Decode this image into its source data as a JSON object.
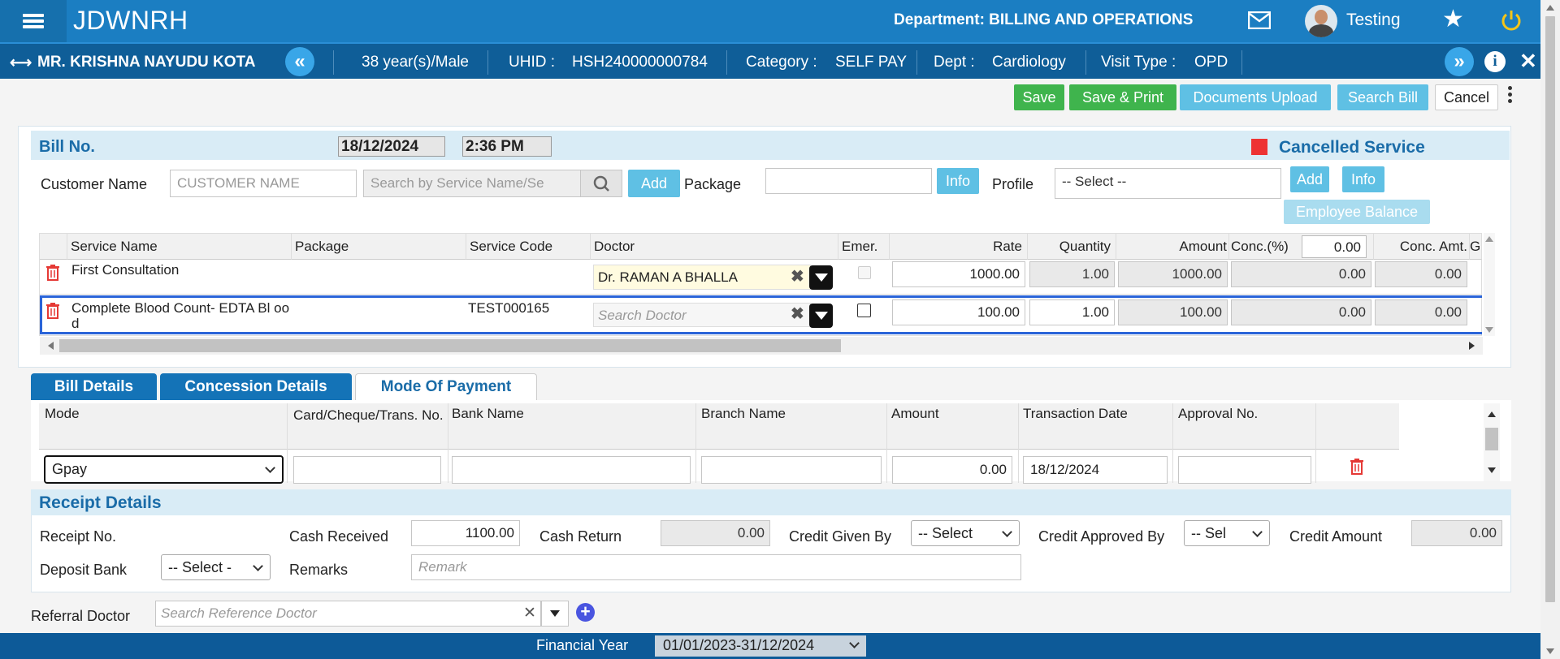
{
  "app": {
    "title": "JDWNRH",
    "department_label": "Department: BILLING AND OPERATIONS",
    "user": "Testing"
  },
  "patient": {
    "name": "MR. KRISHNA NAYUDU KOTA",
    "age_sex": "38 year(s)/Male",
    "uhid_label": "UHID :",
    "uhid": "HSH240000000784",
    "category_label": "Category :",
    "category": "SELF PAY",
    "dept_label": "Dept :",
    "dept": "Cardiology",
    "visit_label": "Visit Type :",
    "visit": "OPD"
  },
  "toolbar": {
    "save": "Save",
    "save_print": "Save & Print",
    "docs": "Documents Upload",
    "search_bill": "Search Bill",
    "cancel": "Cancel"
  },
  "bill": {
    "title": "Bill No.",
    "date": "18/12/2024",
    "time": "2:36 PM",
    "cancelled_label": "Cancelled Service",
    "customer_label": "Customer Name",
    "customer_placeholder": "CUSTOMER NAME",
    "service_placeholder": "Search by Service Name/Se",
    "add": "Add",
    "package_label": "Package",
    "info": "Info",
    "profile_label": "Profile",
    "profile_value": "-- Select --",
    "add2": "Add",
    "info2": "Info",
    "employee_balance": "Employee Balance"
  },
  "grid": {
    "headers": {
      "service": "Service Name",
      "package": "Package",
      "code": "Service Code",
      "doctor": "Doctor",
      "emer": "Emer.",
      "rate": "Rate",
      "qty": "Quantity",
      "amount": "Amount",
      "conc_pct": "Conc.(%)",
      "conc_pct_value": "0.00",
      "conc_amt": "Conc. Amt.",
      "g": "G"
    },
    "rows": [
      {
        "service": "First Consultation",
        "package": "",
        "code": "",
        "doctor": "Dr. RAMAN A BHALLA",
        "rate": "1000.00",
        "qty": "1.00",
        "amount": "1000.00",
        "conc_pct": "0.00",
        "conc_amt": "0.00"
      },
      {
        "service": "Complete Blood Count- EDTA Bl ood",
        "package": "",
        "code": "TEST000165",
        "doctor_placeholder": "Search Doctor",
        "rate": "100.00",
        "qty": "1.00",
        "amount": "100.00",
        "conc_pct": "0.00",
        "conc_amt": "0.00"
      }
    ]
  },
  "tabs": {
    "bill_details": "Bill Details",
    "concession": "Concession Details",
    "payment": "Mode Of Payment"
  },
  "payment": {
    "headers": {
      "mode": "Mode",
      "card": "Card/Cheque/Trans. No.",
      "bank": "Bank Name",
      "branch": "Branch Name",
      "amount": "Amount",
      "date": "Transaction Date",
      "approval": "Approval No."
    },
    "row": {
      "mode": "Gpay",
      "amount": "0.00",
      "date": "18/12/2024"
    }
  },
  "receipt": {
    "title": "Receipt Details",
    "receipt_no": "Receipt No.",
    "cash_received_label": "Cash Received",
    "cash_received": "1100.00",
    "cash_return_label": "Cash Return",
    "cash_return": "0.00",
    "credit_given_label": "Credit Given By",
    "credit_given": "-- Select",
    "credit_approved_label": "Credit Approved By",
    "credit_approved": "-- Sel",
    "credit_amount_label": "Credit Amount",
    "credit_amount": "0.00",
    "deposit_label": "Deposit Bank",
    "deposit": "-- Select -",
    "remarks_label": "Remarks",
    "remarks_placeholder": "Remark"
  },
  "referral": {
    "label": "Referral Doctor",
    "placeholder": "Search Reference Doctor"
  },
  "footer": {
    "fy_label": "Financial Year",
    "fy_value": "01/01/2023-31/12/2024"
  },
  "colors": {
    "accent": "#1b7ec2",
    "green": "#3fb44d",
    "cancelled": "#ee3333"
  }
}
